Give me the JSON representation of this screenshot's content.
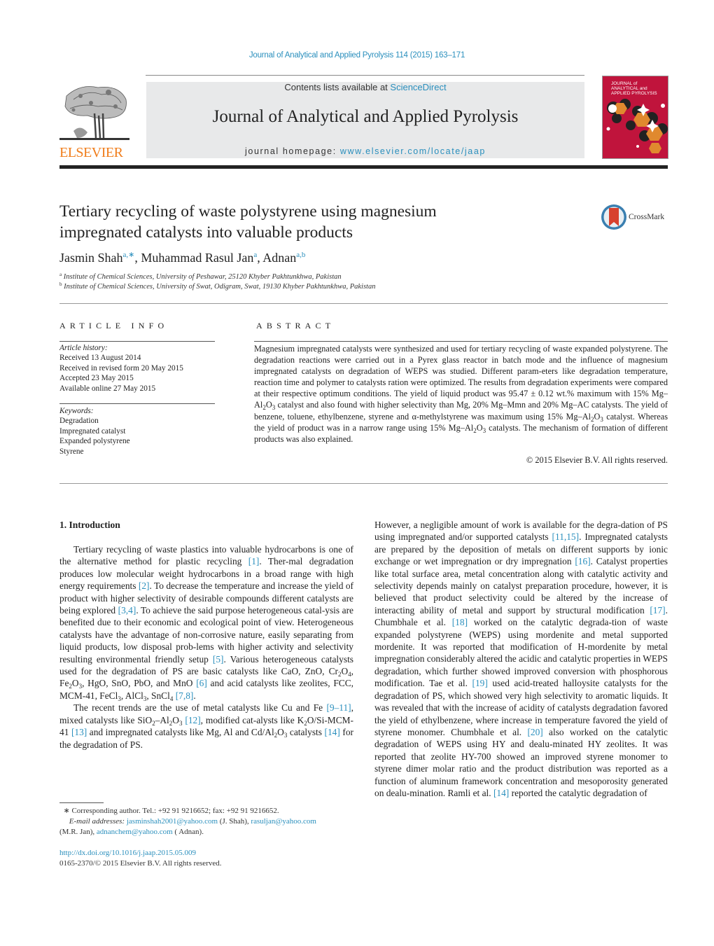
{
  "running_head": "Journal of Analytical and Applied Pyrolysis 114 (2015) 163–171",
  "publisher": {
    "logo_word": "ELSEVIER",
    "brand_color": "#f07d1b"
  },
  "masthead": {
    "contents_prefix": "Contents lists available at ",
    "contents_link": "ScienceDirect",
    "journal_title": "Journal of Analytical and Applied Pyrolysis",
    "homepage_prefix": "journal homepage: ",
    "homepage_link": "www.elsevier.com/locate/jaap",
    "link_color": "#2a8fbd"
  },
  "cover": {
    "lines": [
      "JOURNAL of",
      "ANALYTICAL and",
      "APPLIED PYROLYSIS"
    ],
    "color": "#c0143c"
  },
  "crossmark_label": "CrossMark",
  "article": {
    "title_line1": "Tertiary recycling of waste polystyrene using magnesium",
    "title_line2": "impregnated catalysts into valuable products",
    "authors": [
      {
        "name": "Jasmin Shah",
        "sup": "a,∗"
      },
      {
        "name": "Muhammad Rasul Jan",
        "sup": "a"
      },
      {
        "name": "Adnan",
        "sup": "a,b"
      }
    ],
    "separator": ", ",
    "affiliations": [
      {
        "key": "a",
        "text": "Institute of Chemical Sciences, University of Peshawar, 25120 Khyber Pakhtunkhwa, Pakistan"
      },
      {
        "key": "b",
        "text": "Institute of Chemical Sciences, University of Swat, Odigram, Swat, 19130 Khyber Pakhtunkhwa, Pakistan"
      }
    ]
  },
  "article_info": {
    "heading": "ARTICLE INFO",
    "history_label": "Article history:",
    "history": [
      "Received 13 August 2014",
      "Received in revised form 20 May 2015",
      "Accepted 23 May 2015",
      "Available online 27 May 2015"
    ],
    "keywords_label": "Keywords:",
    "keywords": [
      "Degradation",
      "Impregnated catalyst",
      "Expanded polystyrene",
      "Styrene"
    ]
  },
  "abstract": {
    "heading": "ABSTRACT",
    "s1": "Magnesium impregnated catalysts were synthesized and used for tertiary recycling of waste expanded polystyrene. The degradation reactions were carried out in a Pyrex glass reactor in batch mode and the influence of magnesium impregnated catalysts on degradation of WEPS was studied. Different param-eters like degradation temperature, reaction time and polymer to catalysts ration were optimized. The results from degradation experiments were compared at their respective optimum conditions. The yield of liquid product was 95.47 ± 0.12 wt.% maximum with 15% Mg–Al",
    "s2": " catalyst and also found with higher selectivity than Mg, 20% Mg–Mmn and 20% Mg–AC catalysts. The yield of benzene, toluene, ethylbenzene, styrene and α-methylstyrene was maximum using 15% Mg–Al",
    "s3": " catalyst. Whereas the yield of product was in a narrow range using 15% Mg–Al",
    "s4": " catalysts. The mechanism of formation of different products was also explained.",
    "copyright": "© 2015 Elsevier B.V. All rights reserved."
  },
  "intro": {
    "heading": "1.  Introduction",
    "left": {
      "p1a": "Tertiary recycling of waste plastics into valuable hydrocarbons is one of the alternative method for plastic recycling ",
      "r1": "[1]",
      "p1b": ". Ther-mal degradation produces low molecular weight hydrocarbons in a broad range with high energy requirements ",
      "r2": "[2]",
      "p1c": ". To decrease the temperature and increase the yield of product with higher selectivity of desirable compounds different catalysts are being explored ",
      "r3": "[3,4]",
      "p1d": ". To achieve the said purpose heterogeneous catal-ysis are benefited due to their economic and ecological point of view. Heterogeneous catalysts have the advantage of non-corrosive nature, easily separating from liquid products, low disposal prob-lems with higher activity and selectivity resulting environmental friendly setup ",
      "r4": "[5]",
      "p1e": ". Various heterogeneous catalysts used for the degradation of PS are basic catalysts like CaO, ZnO, Cr",
      "p1f": "O",
      "p1g": ", Fe",
      "p1h": "O",
      "p1i": ", HgO, SnO, PbO, and MnO ",
      "r5": "[6]",
      "p1j": " and acid catalysts like zeolites, FCC, MCM-41, FeCl",
      "p1k": ", AlCl",
      "p1l": ", SnCl",
      "p1m": " ",
      "r6": "[7,8]",
      "p1n": ".",
      "p2a": "The recent trends are the use of metal catalysts like Cu and Fe ",
      "r7": "[9–11]",
      "p2b": ", mixed catalysts like SiO",
      "p2c": "–Al",
      "p2d": "O",
      "p2e": " ",
      "r8": "[12]",
      "p2f": ", modified cat-alysts like K",
      "p2g": "O/Si-MCM-41 ",
      "r9": "[13]",
      "p2h": " and impregnated catalysts like Mg, Al and Cd/Al",
      "p2i": "O",
      "p2j": " catalysts ",
      "r10": "[14]",
      "p2k": " for the degradation of PS."
    },
    "right": {
      "a": "However, a negligible amount of work is available for the degra-dation of PS using impregnated and/or supported catalysts ",
      "r1": "[11,15]",
      "b": ". Impregnated catalysts are prepared by the deposition of metals on different supports by ionic exchange or wet impregnation or dry impregnation ",
      "r2": "[16]",
      "c": ". Catalyst properties like total surface area, metal concentration along with catalytic activity and selectivity depends mainly on catalyst preparation procedure, however, it is believed that product selectivity could be altered by the increase of interacting ability of metal and support by structural modification ",
      "r3": "[17]",
      "d": ". Chumbhale et al. ",
      "r4": "[18]",
      "e": " worked on the catalytic degrada-tion of waste expanded polystyrene (WEPS) using mordenite and metal supported mordenite. It was reported that modification of H-mordenite by metal impregnation considerably altered the acidic and catalytic properties in WEPS degradation, which further showed improved conversion with phosphorous modification. Tae et al. ",
      "r5": "[19]",
      "f": " used acid-treated halloysite catalysts for the degradation of PS, which showed very high selectivity to aromatic liquids. It was revealed that with the increase of acidity of catalysts degradation favored the yield of ethylbenzene, where increase in temperature favored the yield of styrene monomer. Chumbhale et al. ",
      "r6": "[20]",
      "g": " also worked on the catalytic degradation of WEPS using HY and dealu-minated HY zeolites. It was reported that zeolite HY-700 showed an improved styrene monomer to styrene dimer molar ratio and the product distribution was reported as a function of aluminum framework concentration and mesoporosity generated on dealu-mination. Ramli et al. ",
      "r7": "[14]",
      "h": " reported the catalytic degradation of"
    }
  },
  "footnotes": {
    "star": "∗",
    "corresponding": " Corresponding author. Tel.: +92 91 9216652; fax: +92 91 9216652.",
    "email_label": "E-mail addresses:",
    "email1": "jasminshah2001@yahoo.com",
    "email1_owner": " (J. Shah), ",
    "email2": "rasuljan@yahoo.com",
    "email2_owner": "(M.R. Jan), ",
    "email3": "adnanchem@yahoo.com",
    "email3_owner": " ( Adnan).",
    "doi": "http://dx.doi.org/10.1016/j.jaap.2015.05.009",
    "issn_line": "0165-2370/© 2015 Elsevier B.V. All rights reserved."
  },
  "subscripts": {
    "two": "2",
    "three": "3",
    "four": "4"
  }
}
